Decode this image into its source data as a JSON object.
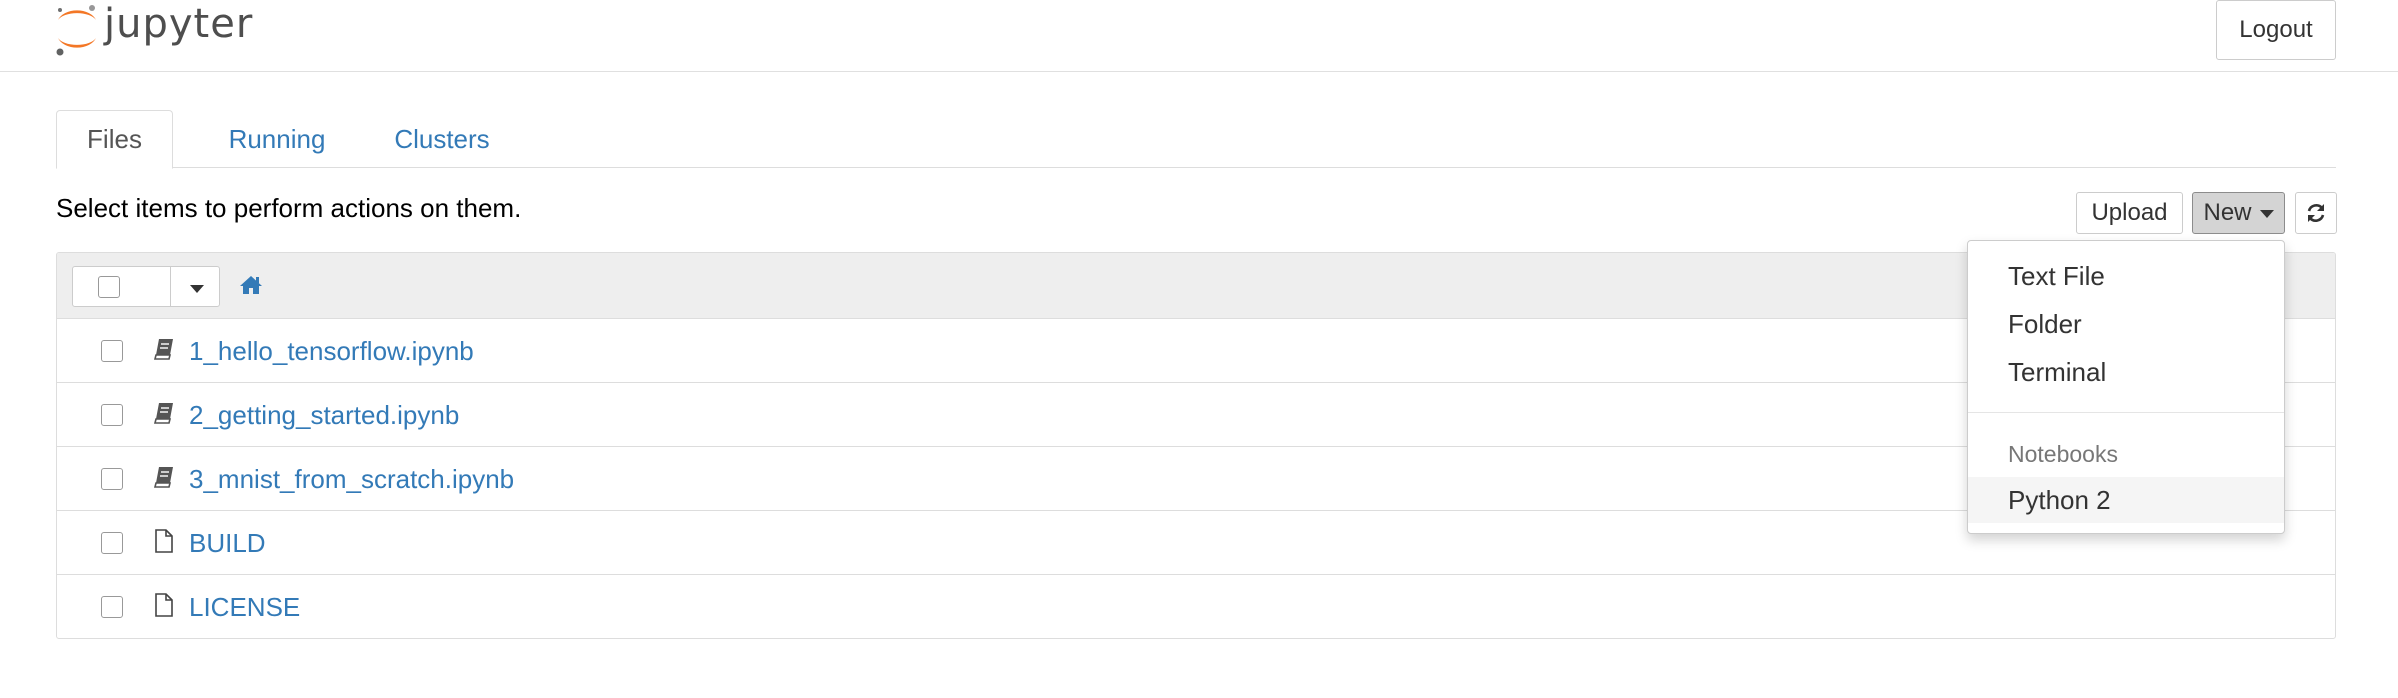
{
  "header": {
    "logo_text": "jupyter",
    "logout_label": "Logout"
  },
  "tabs": [
    {
      "label": "Files",
      "active": true
    },
    {
      "label": "Running",
      "active": false
    },
    {
      "label": "Clusters",
      "active": false
    }
  ],
  "toolbar": {
    "hint": "Select items to perform actions on them.",
    "upload_label": "Upload",
    "new_label": "New",
    "refresh_icon": "refresh-icon"
  },
  "files": [
    {
      "name": "1_hello_tensorflow.ipynb",
      "icon": "notebook-icon"
    },
    {
      "name": "2_getting_started.ipynb",
      "icon": "notebook-icon"
    },
    {
      "name": "3_mnist_from_scratch.ipynb",
      "icon": "notebook-icon"
    },
    {
      "name": "BUILD",
      "icon": "file-icon"
    },
    {
      "name": "LICENSE",
      "icon": "file-icon"
    }
  ],
  "new_menu": {
    "items": [
      "Text File",
      "Folder",
      "Terminal"
    ],
    "section_header": "Notebooks",
    "kernels": [
      "Python 2"
    ]
  },
  "colors": {
    "link": "#337ab7",
    "logo_orange": "#f37726",
    "logo_gray": "#616262"
  }
}
